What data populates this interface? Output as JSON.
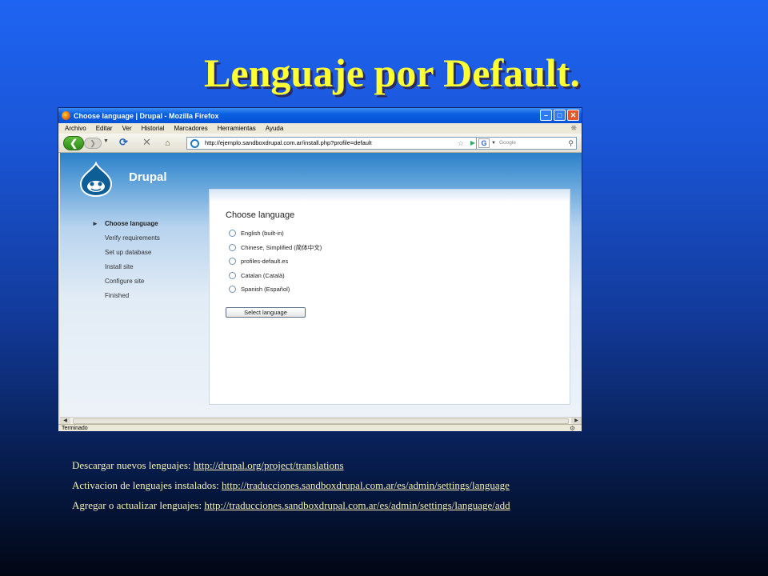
{
  "slide": {
    "title": "Lenguaje por Default."
  },
  "browser": {
    "window_title": "Choose language | Drupal - Mozilla Firefox",
    "menu": [
      "Archivo",
      "Editar",
      "Ver",
      "Historial",
      "Marcadores",
      "Herramientas",
      "Ayuda"
    ],
    "url": "http://ejemplo.sandboxdrupal.com.ar/install.php?profile=default",
    "search_placeholder": "Google",
    "status": "Terminado"
  },
  "drupal": {
    "brand": "Drupal",
    "steps": [
      "Choose language",
      "Verify requirements",
      "Set up database",
      "Install site",
      "Configure site",
      "Finished"
    ],
    "panel_title": "Choose language",
    "options": [
      "English (built-in)",
      "Chinese, Simplified (简体中文)",
      "profiles-default.es",
      "Catalan (Català)",
      "Spanish (Español)"
    ],
    "button_label": "Select language"
  },
  "links": [
    {
      "label": "Descargar nuevos lenguajes: ",
      "url": "http://drupal.org/project/translations"
    },
    {
      "label": "Activacion de lenguajes instalados: ",
      "url": "http://traducciones.sandboxdrupal.com.ar/es/admin/settings/language"
    },
    {
      "label": "Agregar o actualizar lenguajes: ",
      "url": "http://traducciones.sandboxdrupal.com.ar/es/admin/settings/language/add"
    }
  ],
  "colors": {
    "title": "#ffff33",
    "link_text": "#f3efb3",
    "drupal_blue": "#2b80c9"
  }
}
